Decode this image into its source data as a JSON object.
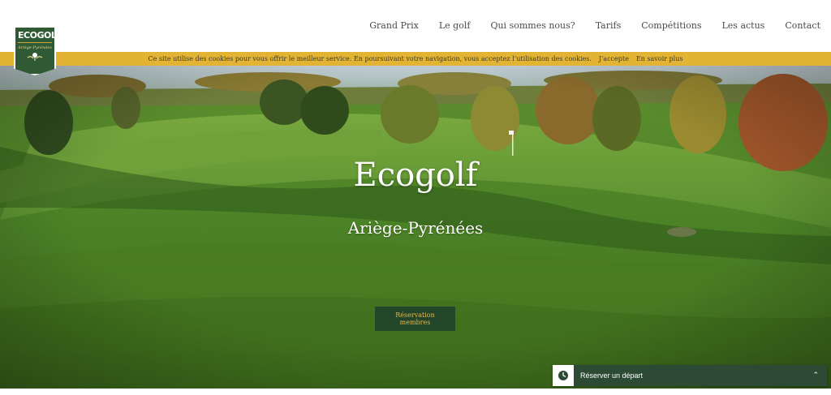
{
  "brand": {
    "logo_word": "ECOGOLF",
    "logo_sub": "Ariège-Pyrénées"
  },
  "nav": {
    "items": [
      {
        "label": "Grand Prix"
      },
      {
        "label": "Le golf"
      },
      {
        "label": "Qui sommes nous?"
      },
      {
        "label": "Tarifs"
      },
      {
        "label": "Compétitions"
      },
      {
        "label": "Les actus"
      },
      {
        "label": "Contact"
      }
    ]
  },
  "cookie": {
    "message": "Ce site utilise des cookies pour vous offrir le meilleur service. En poursuivant votre navigation, vous acceptez l’utilisation des cookies.",
    "accept_label": "J'accepte",
    "more_label": "En savoir plus"
  },
  "hero": {
    "title": "Ecogolf",
    "subtitle": "Ariège-Pyrénées",
    "button_label": "Réservation membres"
  },
  "booking": {
    "label": "Réserver un départ",
    "icon": "clock-icon",
    "toggle_icon": "chevron-up-icon"
  },
  "colors": {
    "brand_green": "#2f5a34",
    "cookie_bar": "#e3b333",
    "button_bg": "#23462b",
    "button_text": "#e3b84a",
    "booking_bg": "#2d4a35"
  }
}
